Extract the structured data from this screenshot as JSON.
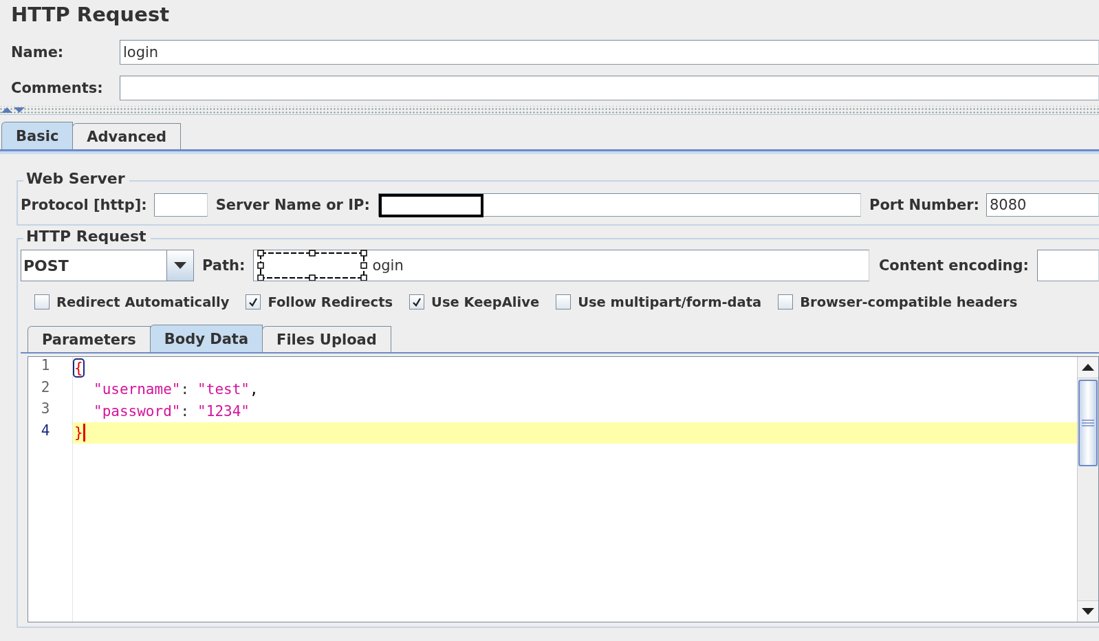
{
  "title": "HTTP Request",
  "name": {
    "label": "Name:",
    "value": "login"
  },
  "comments": {
    "label": "Comments:"
  },
  "tabs": [
    {
      "label": "Basic",
      "selected": true
    },
    {
      "label": "Advanced",
      "selected": false
    }
  ],
  "web_server": {
    "legend": "Web Server",
    "protocol": {
      "label": "Protocol [http]:"
    },
    "server": {
      "label": "Server Name or IP:"
    },
    "port": {
      "label": "Port Number:",
      "value": "8080"
    }
  },
  "http_request": {
    "legend": "HTTP Request",
    "method": "POST",
    "path": {
      "label": "Path:",
      "value": "ogin"
    },
    "encoding": {
      "label": "Content encoding:"
    }
  },
  "options": [
    {
      "label": "Redirect Automatically",
      "checked": false
    },
    {
      "label": "Follow Redirects",
      "checked": true
    },
    {
      "label": "Use KeepAlive",
      "checked": true
    },
    {
      "label": "Use multipart/form-data",
      "checked": false
    },
    {
      "label": "Browser-compatible headers",
      "checked": false
    }
  ],
  "body_tabs": [
    {
      "label": "Parameters",
      "selected": false
    },
    {
      "label": "Body Data",
      "selected": true
    },
    {
      "label": "Files Upload",
      "selected": false
    }
  ],
  "code_lines": [
    {
      "number": "1",
      "current": false,
      "indented": false,
      "tokens": [
        {
          "kind": "bracket-match",
          "text": "{"
        }
      ]
    },
    {
      "number": "2",
      "current": false,
      "indented": true,
      "tokens": [
        {
          "kind": "string",
          "text": "\"username\""
        },
        {
          "kind": "punct",
          "text": ":"
        },
        {
          "kind": "string",
          "text": "\"test\""
        },
        {
          "kind": "comma",
          "text": ","
        }
      ]
    },
    {
      "number": "3",
      "current": false,
      "indented": true,
      "tokens": [
        {
          "kind": "string",
          "text": "\"password\""
        },
        {
          "kind": "punct",
          "text": ":"
        },
        {
          "kind": "string",
          "text": "\"1234\""
        }
      ]
    },
    {
      "number": "4",
      "current": true,
      "indented": false,
      "tokens": [
        {
          "kind": "bracket",
          "text": "}"
        }
      ]
    }
  ]
}
